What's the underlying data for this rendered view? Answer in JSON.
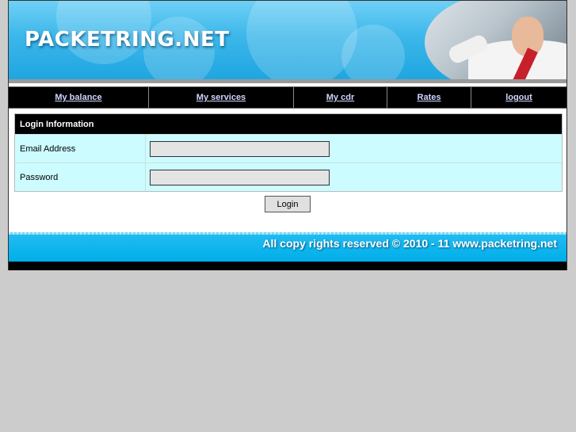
{
  "header": {
    "logo_text": "PACKETRING.NET"
  },
  "nav": {
    "items": [
      {
        "label": "My balance"
      },
      {
        "label": "My services"
      },
      {
        "label": "My cdr"
      },
      {
        "label": "Rates"
      },
      {
        "label": "logout"
      }
    ]
  },
  "login_panel": {
    "title": "Login Information",
    "email_label": "Email Address",
    "email_value": "",
    "password_label": "Password",
    "password_value": "",
    "button_label": "Login"
  },
  "footer": {
    "copyright": "All copy rights reserved © 2010 - 11  www.packetring.net"
  },
  "colors": {
    "page_bg": "#cccccc",
    "header_blue": "#3cb7ea",
    "nav_bg": "#000000",
    "nav_link": "#cfd6ff",
    "row_bg": "#ccfcff",
    "footer_blue": "#00aee9"
  }
}
